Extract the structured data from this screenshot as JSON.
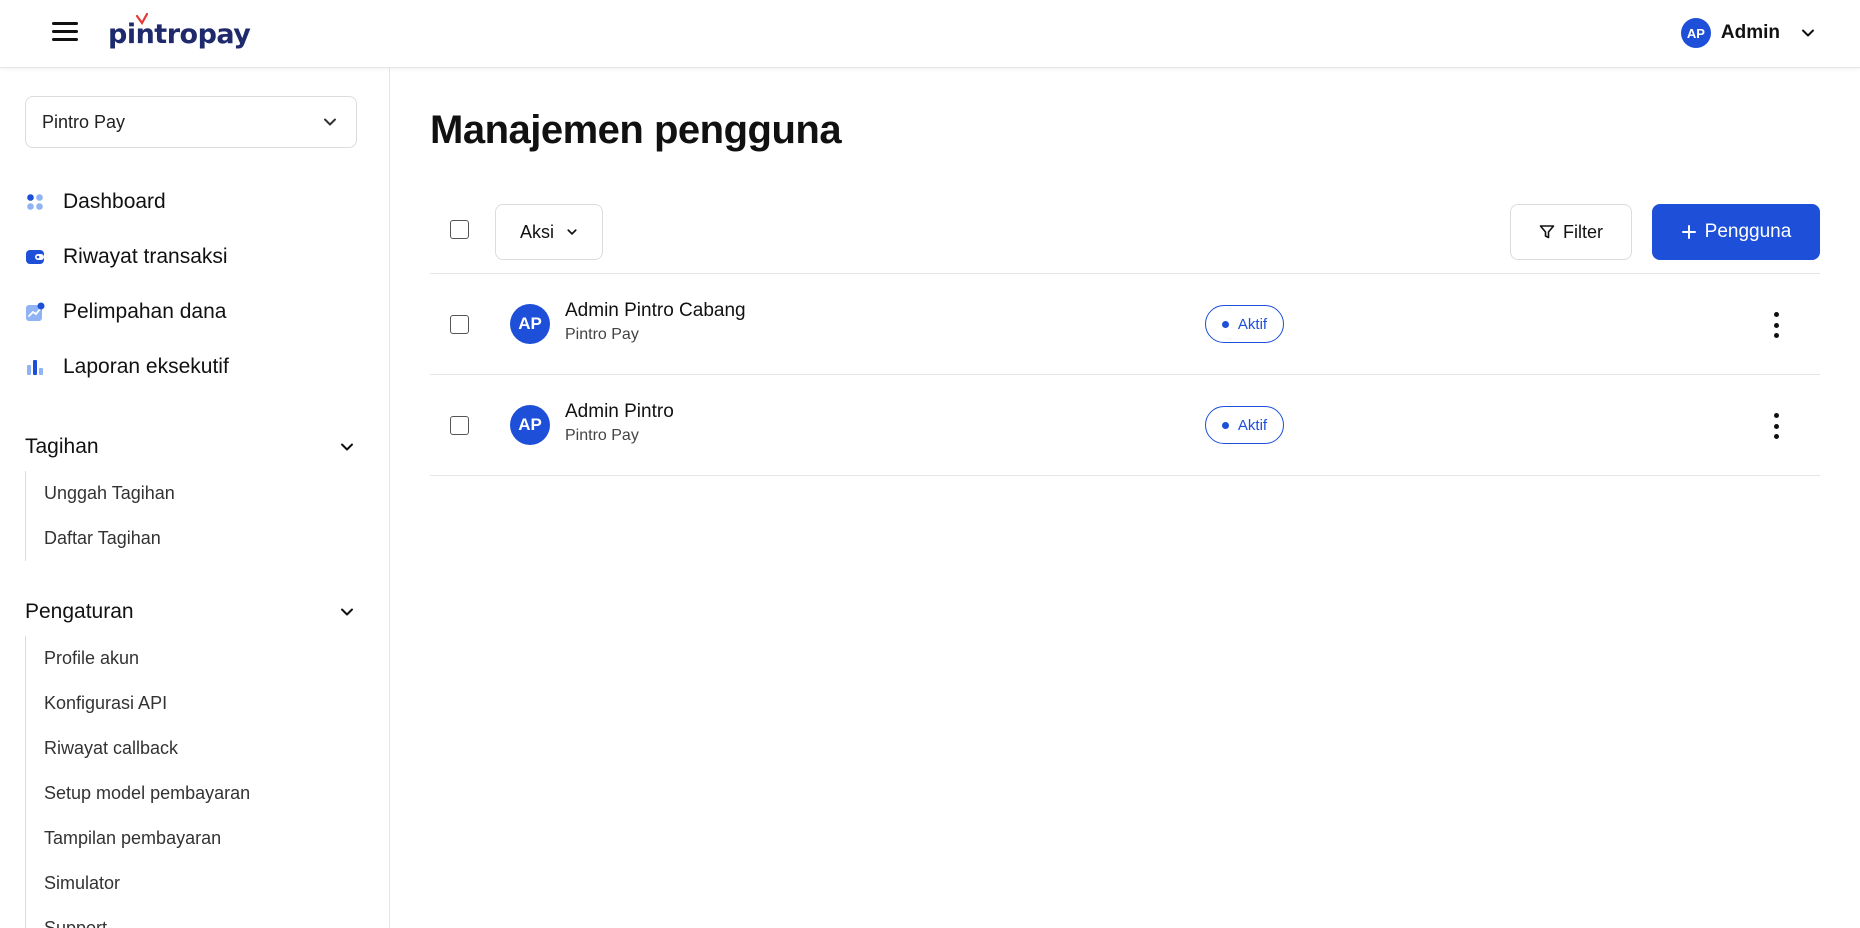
{
  "header": {
    "logo_text": "pintropay",
    "user_initials": "AP",
    "user_name": "Admin"
  },
  "sidebar": {
    "workspace": "Pintro Pay",
    "nav": [
      {
        "label": "Dashboard",
        "icon": "dashboard-icon"
      },
      {
        "label": "Riwayat transaksi",
        "icon": "wallet-icon"
      },
      {
        "label": "Pelimpahan dana",
        "icon": "transfer-icon"
      },
      {
        "label": "Laporan eksekutif",
        "icon": "bar-chart-icon"
      }
    ],
    "sections": [
      {
        "title": "Tagihan",
        "items": [
          "Unggah Tagihan",
          "Daftar Tagihan"
        ]
      },
      {
        "title": "Pengaturan",
        "items": [
          "Profile akun",
          "Konfigurasi API",
          "Riwayat callback",
          "Setup model pembayaran",
          "Tampilan pembayaran",
          "Simulator",
          "Support"
        ]
      }
    ]
  },
  "main": {
    "title": "Manajemen pengguna",
    "toolbar": {
      "aksi_label": "Aksi",
      "filter_label": "Filter",
      "add_label": "Pengguna"
    },
    "users": [
      {
        "initials": "AP",
        "name": "Admin Pintro Cabang",
        "org": "Pintro Pay",
        "status": "Aktif"
      },
      {
        "initials": "AP",
        "name": "Admin Pintro",
        "org": "Pintro Pay",
        "status": "Aktif"
      }
    ]
  },
  "colors": {
    "primary": "#1d4fd8",
    "logo": "#1e2a6b",
    "accent_tick": "#e53935"
  }
}
